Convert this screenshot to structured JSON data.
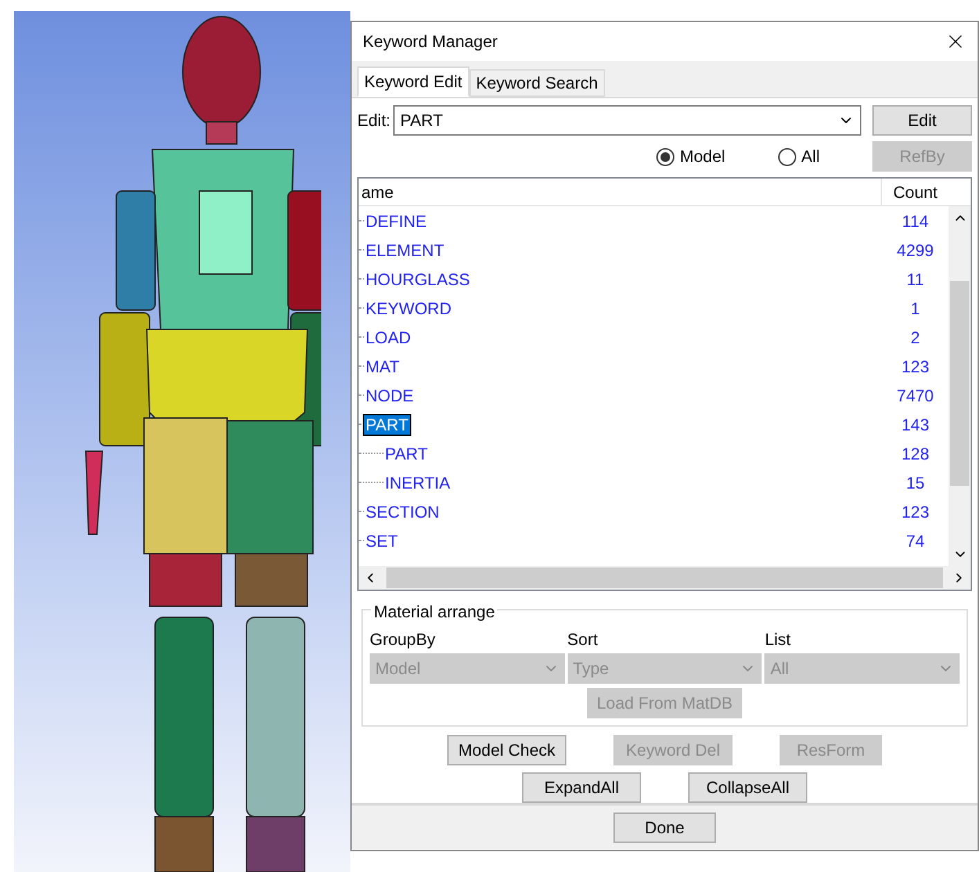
{
  "viewport": {
    "kind": "model-view"
  },
  "dialog": {
    "title": "Keyword Manager",
    "tabs": [
      {
        "label": "Keyword Edit",
        "selected": true
      },
      {
        "label": "Keyword Search",
        "selected": false
      }
    ],
    "edit": {
      "label": "Edit:",
      "value": "PART",
      "button": "Edit"
    },
    "scope": [
      {
        "label": "Model",
        "selected": true
      },
      {
        "label": "All",
        "selected": false
      }
    ],
    "refby": {
      "label": "RefBy",
      "disabled": true
    },
    "tree": {
      "columns": [
        "ame",
        "Count"
      ],
      "items": [
        {
          "name": "DEFINE",
          "count": "114",
          "selected": false
        },
        {
          "name": "ELEMENT",
          "count": "4299",
          "selected": false
        },
        {
          "name": "HOURGLASS",
          "count": "11",
          "selected": false
        },
        {
          "name": "KEYWORD",
          "count": "1",
          "selected": false
        },
        {
          "name": "LOAD",
          "count": "2",
          "selected": false
        },
        {
          "name": "MAT",
          "count": "123",
          "selected": false
        },
        {
          "name": "NODE",
          "count": "7470",
          "selected": false
        },
        {
          "name": "PART",
          "count": "143",
          "selected": true,
          "children": [
            {
              "name": "PART",
              "count": "128",
              "selected": false
            },
            {
              "name": "INERTIA",
              "count": "15",
              "selected": false
            }
          ]
        },
        {
          "name": "SECTION",
          "count": "123",
          "selected": false
        },
        {
          "name": "SET",
          "count": "74",
          "selected": false
        }
      ]
    },
    "material_arrange": {
      "title": "Material arrange",
      "fields": [
        {
          "label": "GroupBy",
          "value": "Model",
          "disabled": true
        },
        {
          "label": "Sort",
          "value": "Type",
          "disabled": true
        },
        {
          "label": "List",
          "value": "All",
          "disabled": true
        }
      ],
      "load_button": {
        "label": "Load From MatDB",
        "disabled": true
      }
    },
    "action_rows": [
      [
        {
          "label": "Model Check",
          "disabled": false
        },
        {
          "label": "Keyword Del",
          "disabled": true
        },
        {
          "label": "ResForm",
          "disabled": true
        }
      ],
      [
        {
          "label": "ExpandAll",
          "disabled": false
        },
        {
          "label": "CollapseAll",
          "disabled": false
        }
      ]
    ],
    "done": "Done"
  }
}
